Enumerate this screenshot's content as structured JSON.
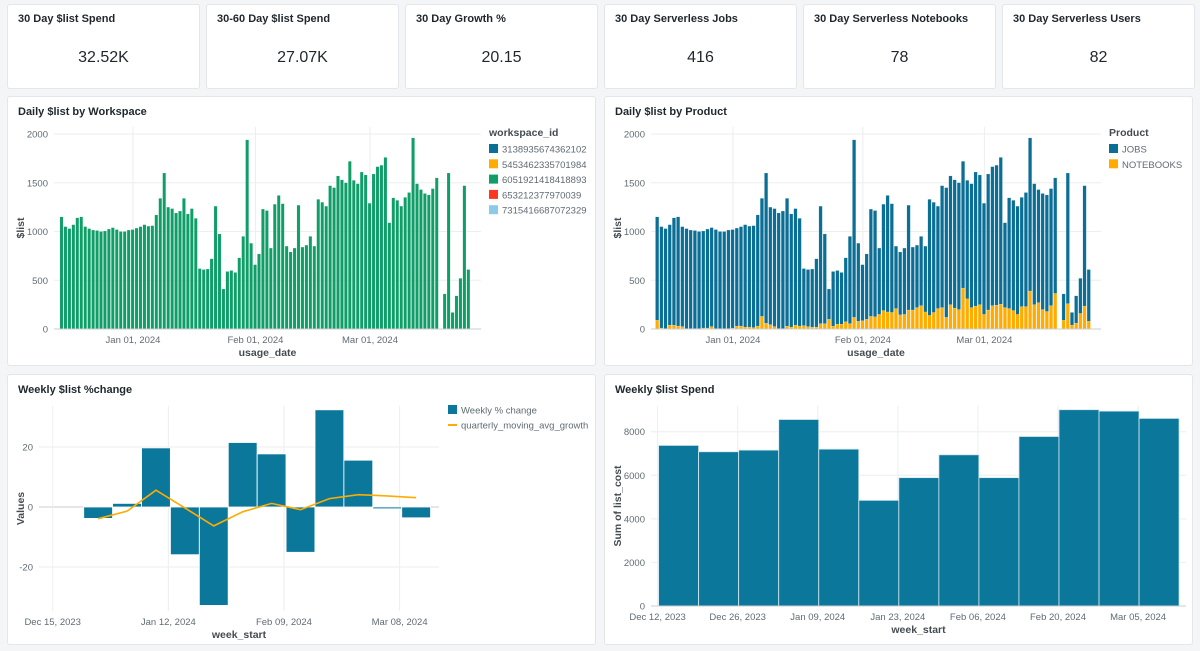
{
  "kpis": [
    {
      "title": "30 Day $list Spend",
      "value": "32.52K"
    },
    {
      "title": "30-60 Day $list Spend",
      "value": "27.07K"
    },
    {
      "title": "30 Day Growth %",
      "value": "20.15"
    },
    {
      "title": "30 Day Serverless Jobs",
      "value": "416"
    },
    {
      "title": "30 Day Serverless Notebooks",
      "value": "78"
    },
    {
      "title": "30 Day Serverless Users",
      "value": "82"
    }
  ],
  "chart_data": [
    {
      "id": "workspace",
      "type": "bar",
      "stacked": true,
      "title": "Daily $list by Workspace",
      "xlabel": "usage_date",
      "ylabel": "$list",
      "ylim": [
        0,
        2000
      ],
      "yticks": [
        0,
        500,
        1000,
        1500,
        2000
      ],
      "xticks": [
        {
          "date": "2024-01-01",
          "label": "Jan 01, 2024"
        },
        {
          "date": "2024-02-01",
          "label": "Feb 01, 2024"
        },
        {
          "date": "2024-03-01",
          "label": "Mar 01, 2024"
        }
      ],
      "grid": true,
      "legend_title": "workspace_id",
      "legend_position": "right",
      "legend": [
        {
          "name": "3138935674362102",
          "color": "#0b6e95"
        },
        {
          "name": "5453462335701984",
          "color": "#ffab00"
        },
        {
          "name": "6051921418418893",
          "color": "#0f9d68"
        },
        {
          "name": "653212377970039",
          "color": "#ff3621"
        },
        {
          "name": "7315416687072329",
          "color": "#8ccbe8"
        }
      ],
      "series": [
        {
          "name": "6051921418418893",
          "color": "#0f9d68",
          "values": [
            1150,
            1050,
            1030,
            1070,
            1140,
            1150,
            1050,
            1030,
            1015,
            1010,
            1000,
            1005,
            1025,
            1040,
            1020,
            1000,
            1000,
            1015,
            1020,
            1035,
            1050,
            1070,
            1055,
            1060,
            1170,
            1340,
            1600,
            1250,
            1235,
            1190,
            1210,
            1340,
            1180,
            1235,
            1135,
            620,
            610,
            615,
            720,
            1260,
            975,
            410,
            590,
            600,
            580,
            730,
            950,
            1940,
            880,
            660,
            770,
            1230,
            1215,
            830,
            1280,
            1370,
            1285,
            850,
            790,
            830,
            1270,
            840,
            860,
            950,
            850,
            1330,
            1300,
            1260,
            1470,
            1450,
            1570,
            1530,
            1500,
            1720,
            1525,
            1490,
            1610,
            1580,
            1290,
            1590,
            1665,
            1680,
            1760,
            1090,
            1345,
            1320,
            1260,
            1350,
            1400,
            1960,
            1490,
            1430,
            1390,
            1375,
            1440,
            1550,
            0,
            360,
            1600,
            170,
            340,
            520,
            1470,
            610
          ]
        }
      ]
    },
    {
      "id": "product",
      "type": "bar",
      "stacked": true,
      "title": "Daily $list by Product",
      "xlabel": "usage_date",
      "ylabel": "$list",
      "ylim": [
        0,
        2000
      ],
      "yticks": [
        0,
        500,
        1000,
        1500,
        2000
      ],
      "xticks": [
        {
          "date": "2024-01-01",
          "label": "Jan 01, 2024"
        },
        {
          "date": "2024-02-01",
          "label": "Feb 01, 2024"
        },
        {
          "date": "2024-03-01",
          "label": "Mar 01, 2024"
        }
      ],
      "grid": true,
      "legend_title": "Product",
      "legend_position": "right",
      "series": [
        {
          "name": "NOTEBOOKS",
          "color": "#ffab00",
          "values": [
            90,
            10,
            5,
            40,
            40,
            30,
            25,
            5,
            5,
            5,
            5,
            10,
            10,
            25,
            5,
            5,
            5,
            5,
            10,
            30,
            30,
            20,
            20,
            15,
            30,
            130,
            60,
            45,
            25,
            5,
            5,
            30,
            20,
            40,
            30,
            35,
            25,
            20,
            20,
            55,
            55,
            100,
            30,
            50,
            50,
            75,
            55,
            120,
            80,
            85,
            100,
            130,
            125,
            150,
            190,
            175,
            170,
            210,
            145,
            150,
            195,
            195,
            220,
            240,
            175,
            140,
            170,
            210,
            220,
            120,
            250,
            215,
            200,
            420,
            310,
            220,
            235,
            250,
            150,
            195,
            240,
            245,
            255,
            220,
            210,
            190,
            150,
            230,
            230,
            390,
            250,
            270,
            200,
            180,
            240,
            365,
            0,
            90,
            260,
            40,
            60,
            160,
            235,
            80
          ]
        },
        {
          "name": "JOBS",
          "color": "#0b6e95",
          "values": [
            1060,
            1040,
            1025,
            1030,
            1100,
            1120,
            1025,
            1025,
            1010,
            1005,
            995,
            995,
            1015,
            1015,
            1015,
            995,
            995,
            1010,
            1010,
            1005,
            1020,
            1050,
            1035,
            1045,
            1140,
            1210,
            1540,
            1205,
            1210,
            1185,
            1205,
            1310,
            1160,
            1195,
            1105,
            585,
            585,
            595,
            700,
            1205,
            920,
            310,
            560,
            550,
            530,
            655,
            895,
            1820,
            800,
            575,
            670,
            1100,
            1090,
            680,
            1090,
            1195,
            1115,
            640,
            645,
            680,
            1075,
            645,
            640,
            710,
            675,
            1190,
            1130,
            1050,
            1250,
            1330,
            1320,
            1315,
            1300,
            1300,
            1215,
            1270,
            1375,
            1330,
            1140,
            1395,
            1425,
            1435,
            1505,
            870,
            1135,
            1130,
            1110,
            1120,
            1170,
            1570,
            1240,
            1160,
            1190,
            1195,
            1200,
            1185,
            0,
            270,
            1340,
            130,
            280,
            360,
            1235,
            530
          ]
        }
      ],
      "legend_order": [
        "JOBS",
        "NOTEBOOKS"
      ]
    },
    {
      "id": "pct",
      "type": "bar+line",
      "title": "Weekly $list %change",
      "xlabel": "week_start",
      "ylabel": "Values",
      "ylim": [
        -35,
        33
      ],
      "yticks": [
        -20,
        0,
        20
      ],
      "xticks": [
        {
          "date": "2023-12-15",
          "label": "Dec 15, 2023"
        },
        {
          "date": "2024-01-12",
          "label": "Jan 12, 2024"
        },
        {
          "date": "2024-02-09",
          "label": "Feb 09, 2024"
        },
        {
          "date": "2024-03-08",
          "label": "Mar 08, 2024"
        }
      ],
      "grid": true,
      "legend_position": "right",
      "x": [
        "2023-12-26",
        "2024-01-02",
        "2024-01-09",
        "2024-01-16",
        "2024-01-23",
        "2024-01-30",
        "2024-02-06",
        "2024-02-13",
        "2024-02-20",
        "2024-02-27",
        "2024-03-05",
        "2024-03-12"
      ],
      "series": [
        {
          "name": "Weekly % change",
          "type": "bar",
          "color": "#0b789b",
          "values": [
            -3.8,
            1.2,
            19.7,
            -15.9,
            -32.8,
            21.5,
            17.7,
            -15.1,
            32.4,
            15.6,
            -0.6,
            -3.6
          ]
        },
        {
          "name": "quarterly_moving_avg_growth",
          "type": "line",
          "color": "#ffab00",
          "values": [
            -3.9,
            -1.4,
            5.6,
            -0.3,
            -6.3,
            -1.6,
            1.2,
            -0.9,
            2.8,
            4.1,
            3.7,
            3.1
          ]
        }
      ]
    },
    {
      "id": "spend",
      "type": "bar",
      "title": "Weekly $list Spend",
      "xlabel": "week_start",
      "ylabel": "Sum of list_cost",
      "ylim": [
        0,
        9200
      ],
      "yticks": [
        0,
        2000,
        4000,
        6000,
        8000
      ],
      "xticks": [
        {
          "date": "2023-12-12",
          "label": "Dec 12, 2023"
        },
        {
          "date": "2023-12-26",
          "label": "Dec 26, 2023"
        },
        {
          "date": "2024-01-09",
          "label": "Jan 09, 2024"
        },
        {
          "date": "2024-01-23",
          "label": "Jan 23, 2024"
        },
        {
          "date": "2024-02-06",
          "label": "Feb 06, 2024"
        },
        {
          "date": "2024-02-20",
          "label": "Feb 20, 2024"
        },
        {
          "date": "2024-03-05",
          "label": "Mar 05, 2024"
        }
      ],
      "grid": true,
      "x": [
        "2023-12-12",
        "2023-12-19",
        "2023-12-26",
        "2024-01-02",
        "2024-01-09",
        "2024-01-16",
        "2024-01-23",
        "2024-01-30",
        "2024-02-06",
        "2024-02-13",
        "2024-02-20",
        "2024-02-27",
        "2024-03-05"
      ],
      "series": [
        {
          "color": "#0b789b",
          "values": [
            7370,
            7080,
            7155,
            8560,
            7200,
            4850,
            5890,
            6940,
            5890,
            7780,
            9010,
            8945,
            8610
          ]
        }
      ]
    }
  ]
}
